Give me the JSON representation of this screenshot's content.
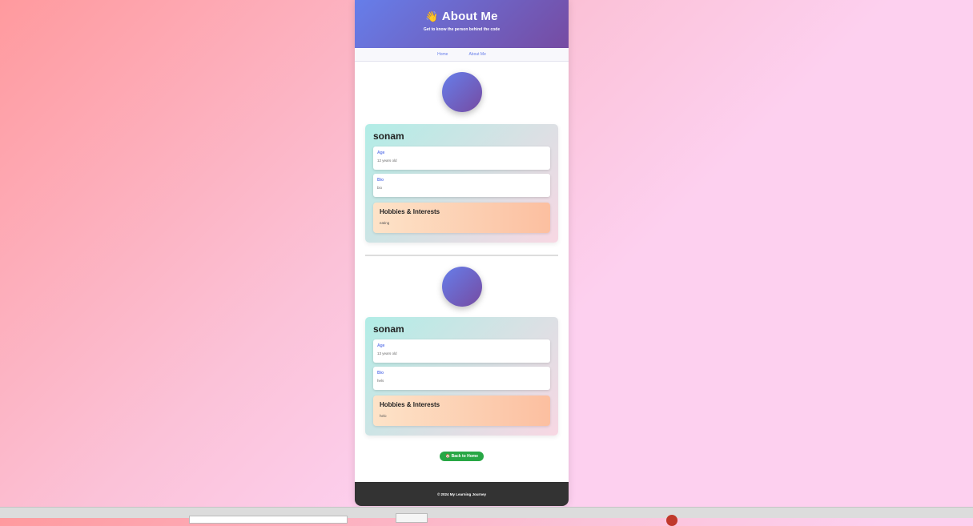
{
  "header": {
    "emoji": "👋",
    "title": "About Me",
    "subtitle": "Get to know the person behind the code"
  },
  "nav": {
    "items": [
      {
        "label": "Home"
      },
      {
        "label": "About Me"
      }
    ]
  },
  "profiles": [
    {
      "name": "sonam",
      "age_label": "Age",
      "age_value": "12 years old",
      "bio_label": "Bio",
      "bio_value": "bio",
      "hobbies_title": "Hobbies & Interests",
      "hobbies_value": "eating"
    },
    {
      "name": "sonam",
      "age_label": "Age",
      "age_value": "13 years old",
      "bio_label": "Bio",
      "bio_value": "hels",
      "hobbies_title": "Hobbies & Interests",
      "hobbies_value": "helo"
    }
  ],
  "back_button": {
    "icon": "🏠",
    "label": "Back to Home"
  },
  "footer": {
    "text": "© 2024 My Learning Journey"
  },
  "colors": {
    "header_gradient_start": "#667eea",
    "header_gradient_end": "#764ba2",
    "accent": "#667eea",
    "back_button": "#28a745",
    "footer_bg": "#333333"
  }
}
